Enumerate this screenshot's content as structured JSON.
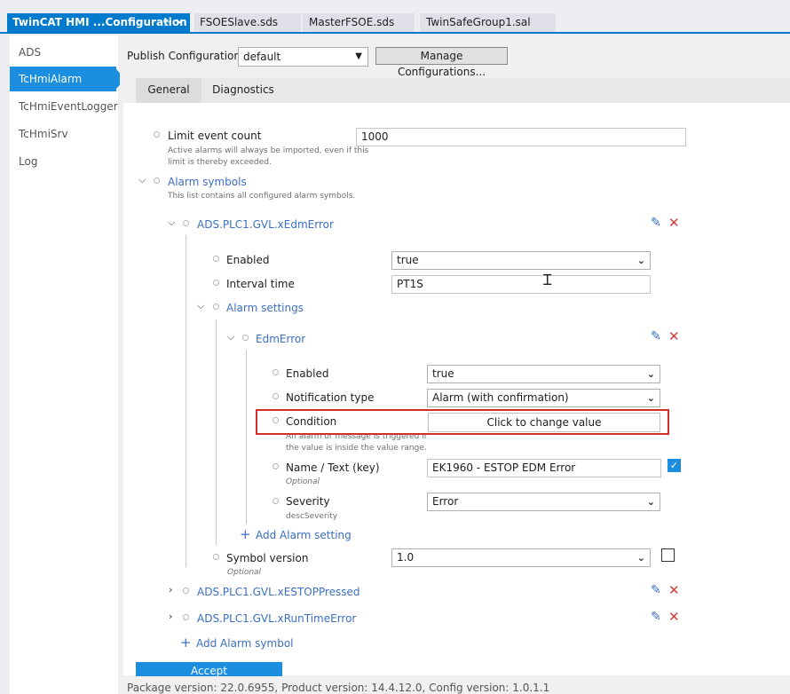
{
  "tabs": [
    {
      "label": "TwinCAT HMI ...Configuration",
      "pin": "⊣ ×"
    },
    {
      "label": "FSOESlave.sds"
    },
    {
      "label": "MasterFSOE.sds"
    },
    {
      "label": "TwinSafeGroup1.sal"
    }
  ],
  "sidebar": {
    "items": [
      {
        "label": "ADS"
      },
      {
        "label": "TcHmiAlarm"
      },
      {
        "label": "TcHmiEventLogger"
      },
      {
        "label": "TcHmiSrv"
      },
      {
        "label": "Log"
      }
    ]
  },
  "publish": {
    "label": "Publish Configuration:",
    "value": "default",
    "manage_label": "Manage Configurations..."
  },
  "subtabs": [
    "General",
    "Diagnostics"
  ],
  "tree": {
    "limit_event_count": {
      "label": "Limit event count",
      "value": "1000",
      "desc_line1": "Active alarms will always be imported, even if this",
      "desc_line2": "limit is thereby exceeded."
    },
    "alarm_symbols": {
      "label": "Alarm symbols",
      "desc": "This list contains all configured alarm symbols."
    },
    "symbol1": {
      "name": "ADS.PLC1.GVL.xEdmError",
      "enabled_label": "Enabled",
      "enabled_value": "true",
      "interval_label": "Interval time",
      "interval_value": "PT1S",
      "alarm_settings_label": "Alarm settings",
      "setting_name": "EdmError",
      "setting_enabled_label": "Enabled",
      "setting_enabled_value": "true",
      "notif_label": "Notification type",
      "notif_value": "Alarm (with confirmation)",
      "condition_label": "Condition",
      "condition_button": "Click to change value",
      "condition_desc1": "An alarm or message is triggered if",
      "condition_desc2": "the value is inside the value range.",
      "name_label": "Name / Text (key)",
      "name_value": "EK1960 - ESTOP EDM Error",
      "name_opt": "Optional",
      "name_checked": true,
      "severity_label": "Severity",
      "severity_value": "Error",
      "severity_desc": "descSeverity",
      "add_setting": "Add Alarm setting",
      "version_label": "Symbol version",
      "version_value": "1.0",
      "version_opt": "Optional"
    },
    "symbol2": {
      "name": "ADS.PLC1.GVL.xESTOPPressed"
    },
    "symbol3": {
      "name": "ADS.PLC1.GVL.xRunTimeError"
    },
    "add_symbol": "Add Alarm symbol"
  },
  "accept_label": "Accept",
  "status": "Package version: 22.0.6955, Product version: 14.4.12.0, Config version: 1.0.1.1",
  "icons": {
    "expanded": "chevron-down-icon",
    "collapsed": "chevron-right-icon",
    "edit": "pencil-icon",
    "delete": "close-icon",
    "add": "plus-icon"
  },
  "colors": {
    "accent": "#007acc",
    "selected": "#1c8ee0",
    "link": "#3b6fc3",
    "delete": "#d83b3b",
    "highlight": "#d62c2c"
  }
}
